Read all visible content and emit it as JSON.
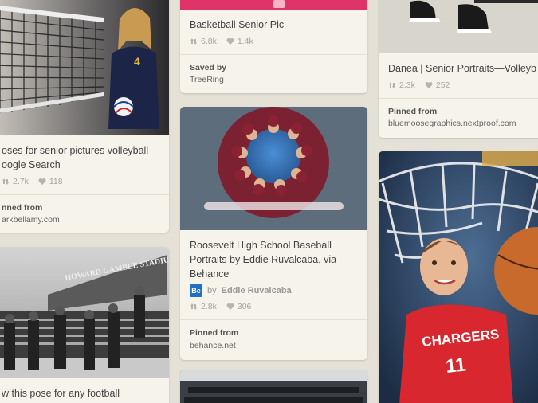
{
  "pins": {
    "volleyball_net": {
      "title_lines": [
        "oses for senior pictures volleyball -",
        "oogle Search"
      ],
      "repins": "2.7k",
      "likes": "118",
      "source_label": "nned from",
      "source_value": "arkbellamy.com"
    },
    "basketball_senior": {
      "title": "Basketball Senior Pic",
      "repins": "6.8k",
      "likes": "1.4k",
      "source_label": "Saved by",
      "source_value": "TreeRing"
    },
    "danea": {
      "title": "Danea | Senior Portraits—Volleyb",
      "repins": "2.3k",
      "likes": "252",
      "source_label": "Pinned from",
      "source_value": "bluemoosegraphics.nextproof.com"
    },
    "roosevelt": {
      "title_lines": [
        "Roosevelt High School Baseball",
        "Portraits by Eddie Ruvalcaba, via",
        "Behance"
      ],
      "via_badge": "Be",
      "via_prefix": "by",
      "via_name": "Eddie Ruvalcaba",
      "repins": "2.8k",
      "likes": "306",
      "source_label": "Pinned from",
      "source_value": "behance.net"
    },
    "football": {
      "title": "w this pose for any football",
      "stadium_sign": "HOWARD GAMBLE STADIUM"
    },
    "chargers": {
      "jersey_text": "CHARGERS",
      "jersey_number": "11"
    }
  },
  "colors": {
    "background": "#e6e1d6",
    "card": "#f6f3ea",
    "pink_banner": "#e0336a",
    "meta_gray": "#a8a49a"
  },
  "icons": [
    "repin-icon",
    "heart-icon"
  ]
}
